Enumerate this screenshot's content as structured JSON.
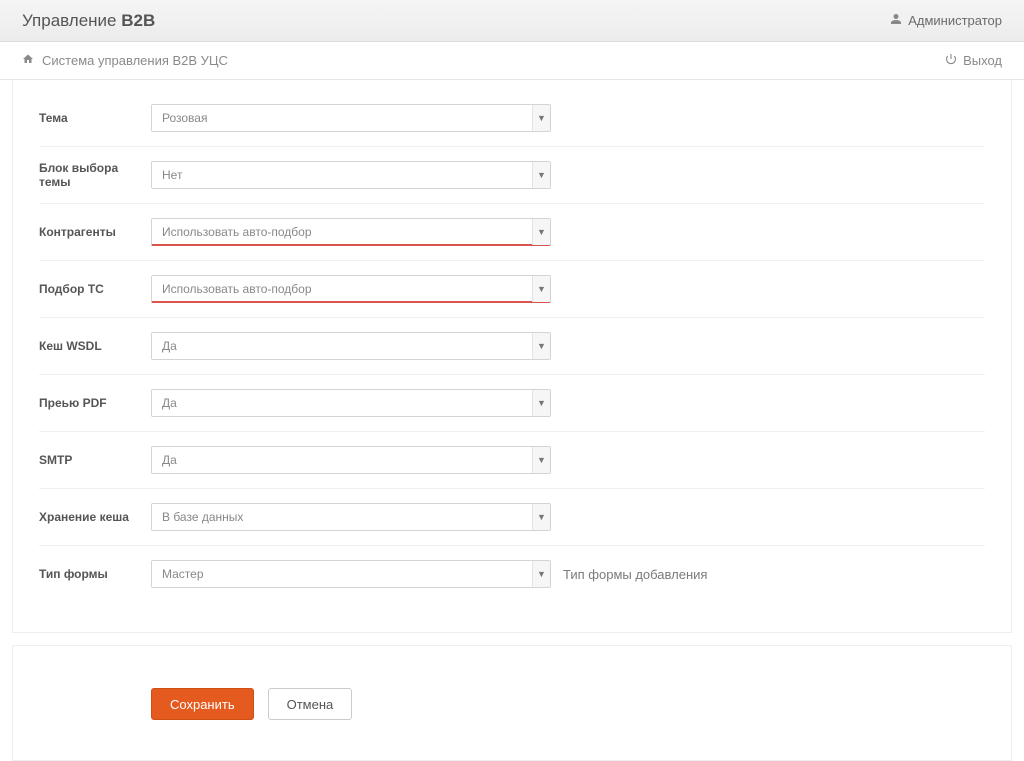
{
  "topbar": {
    "brand_prefix": "Управление ",
    "brand_bold": "B2B",
    "admin_label": "Администратор"
  },
  "crumb": {
    "text": "Система управления B2B УЦС",
    "exit_label": "Выход"
  },
  "fields": {
    "theme": {
      "label": "Тема",
      "value": "Розовая",
      "invalid": false
    },
    "theme_block": {
      "label": "Блок выбора темы",
      "value": "Нет",
      "invalid": false
    },
    "contragents": {
      "label": "Контрагенты",
      "value": "Использовать авто-подбор",
      "invalid": true
    },
    "ts": {
      "label": "Подбор ТС",
      "value": "Использовать авто-подбор",
      "invalid": true
    },
    "wsdl": {
      "label": "Кеш WSDL",
      "value": "Да",
      "invalid": false
    },
    "pdf": {
      "label": "Преью PDF",
      "value": "Да",
      "invalid": false
    },
    "smtp": {
      "label": "SMTP",
      "value": "Да",
      "invalid": false
    },
    "cache": {
      "label": "Хранение кеша",
      "value": "В базе данных",
      "invalid": false
    },
    "form_type": {
      "label": "Тип формы",
      "value": "Мастер",
      "invalid": false,
      "help": "Тип формы добавления"
    }
  },
  "actions": {
    "save": "Сохранить",
    "cancel": "Отмена"
  }
}
